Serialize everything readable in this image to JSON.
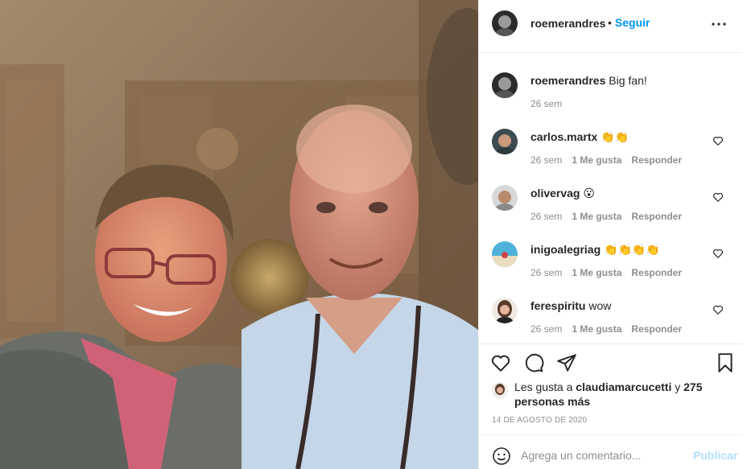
{
  "colors": {
    "accent": "#0095f6",
    "text": "#262626",
    "muted": "#8e8e8e",
    "publish_disabled": "#b2dffc",
    "border": "#efefef"
  },
  "photo": {
    "alt": ""
  },
  "header": {
    "username": "roemerandres",
    "separator": "•",
    "follow_label": "Seguir",
    "more_icon": "more-horizontal-icon"
  },
  "comments": [
    {
      "user": "roemerandres",
      "text": "Big fan!",
      "time": "26 sem",
      "likes": "",
      "reply": ""
    },
    {
      "user": "carlos.martx",
      "text": "👏👏",
      "time": "26 sem",
      "likes": "1 Me gusta",
      "reply": "Responder"
    },
    {
      "user": "olivervag",
      "text": "😮",
      "time": "26 sem",
      "likes": "1 Me gusta",
      "reply": "Responder"
    },
    {
      "user": "inigoalegriag",
      "text": "👏👏👏👏",
      "time": "26 sem",
      "likes": "1 Me gusta",
      "reply": "Responder"
    },
    {
      "user": "ferespiritu",
      "text": "wow",
      "time": "26 sem",
      "likes": "1 Me gusta",
      "reply": "Responder"
    }
  ],
  "likes": {
    "prefix": "Les gusta a",
    "first_user": "claudiamarcucetti",
    "joiner": "y",
    "others": "275 personas más"
  },
  "date": "14 DE AGOSTO DE 2020",
  "add_comment": {
    "placeholder": "Agrega un comentario...",
    "publish_label": "Publicar"
  }
}
